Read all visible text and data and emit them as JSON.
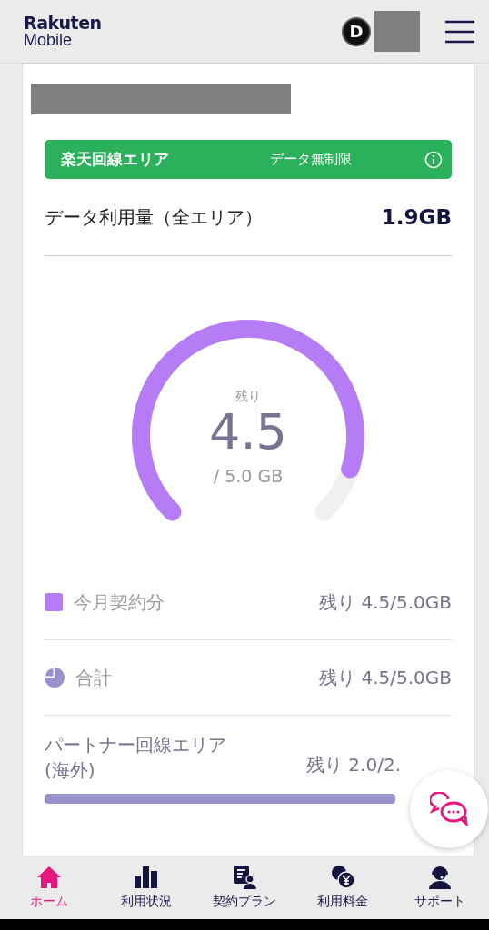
{
  "header": {
    "logo_line_1": "Rakuten",
    "logo_line_2": "Mobile",
    "badge": "D"
  },
  "area_banner": {
    "label": "楽天回線エリア",
    "value": "データ無制限"
  },
  "usage": {
    "label": "データ利用量（全エリア）",
    "value": "1.9GB"
  },
  "gauge": {
    "caption": "残り",
    "value": "4.5",
    "total": "/ 5.0 GB"
  },
  "rows": [
    {
      "kind": "square",
      "label": "今月契約分",
      "value": "残り 4.5/5.0GB",
      "color": "#b57cf5"
    },
    {
      "kind": "pie",
      "label": "合計",
      "value": "残り 4.5/5.0GB",
      "color": "#9892cc"
    },
    {
      "kind": "bar",
      "label": "パートナー回線エリア(海外)",
      "value": "残り 2.0/2.",
      "level": 1.0
    }
  ],
  "nav": [
    {
      "label": "ホーム",
      "kind": "home",
      "selected": true
    },
    {
      "label": "利用状況",
      "kind": "chart",
      "selected": false
    },
    {
      "label": "契約プラン",
      "kind": "plan",
      "selected": false
    },
    {
      "label": "利用料金",
      "kind": "fee",
      "selected": false
    },
    {
      "label": "サポート",
      "kind": "support",
      "selected": false
    }
  ]
}
